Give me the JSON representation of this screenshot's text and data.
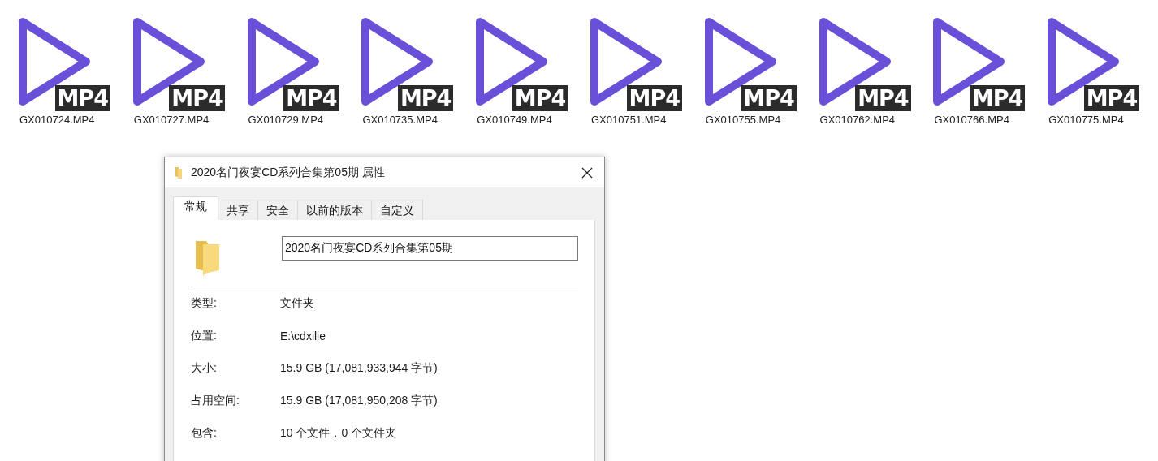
{
  "files": [
    {
      "name": "GX010724.MP4",
      "badge": "MP4"
    },
    {
      "name": "GX010727.MP4",
      "badge": "MP4"
    },
    {
      "name": "GX010729.MP4",
      "badge": "MP4"
    },
    {
      "name": "GX010735.MP4",
      "badge": "MP4"
    },
    {
      "name": "GX010749.MP4",
      "badge": "MP4"
    },
    {
      "name": "GX010751.MP4",
      "badge": "MP4"
    },
    {
      "name": "GX010755.MP4",
      "badge": "MP4"
    },
    {
      "name": "GX010762.MP4",
      "badge": "MP4"
    },
    {
      "name": "GX010766.MP4",
      "badge": "MP4"
    },
    {
      "name": "GX010775.MP4",
      "badge": "MP4"
    }
  ],
  "dialog": {
    "title": "2020名门夜宴CD系列合集第05期 属性",
    "tabs": [
      {
        "label": "常规",
        "selected": true
      },
      {
        "label": "共享",
        "selected": false
      },
      {
        "label": "安全",
        "selected": false
      },
      {
        "label": "以前的版本",
        "selected": false
      },
      {
        "label": "自定义",
        "selected": false
      }
    ],
    "name_field": {
      "value": "2020名门夜宴CD系列合集第05期"
    },
    "properties": [
      {
        "label": "类型:",
        "value": "文件夹"
      },
      {
        "label": "位置:",
        "value": "E:\\cdxilie"
      },
      {
        "label": "大小:",
        "value": "15.9 GB (17,081,933,944 字节)"
      },
      {
        "label": "占用空间:",
        "value": "15.9 GB (17,081,950,208 字节)"
      },
      {
        "label": "包含:",
        "value": "10 个文件，0 个文件夹"
      }
    ]
  }
}
